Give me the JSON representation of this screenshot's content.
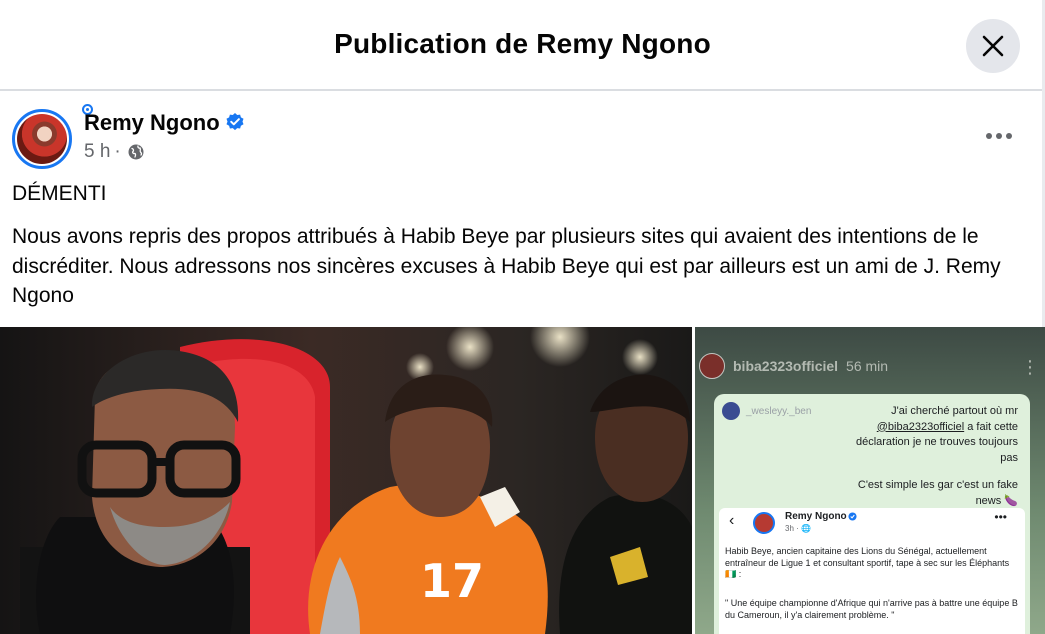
{
  "modal": {
    "title": "Publication de Remy Ngono",
    "close_icon": "close-icon"
  },
  "post": {
    "author": "Remy Ngono",
    "verified_icon": "verified-badge-icon",
    "time": "5 h",
    "separator": "·",
    "audience_icon": "globe-icon",
    "more_icon": "more-options-icon",
    "heading": "DÉMENTI",
    "body": "Nous avons repris des propos attribués à Habib Beye par plusieurs sites qui avaient des intentions de le discréditer. Nous adressons nos sincères excuses à Habib Beye qui est par ailleurs est un ami de J. Remy Ngono"
  },
  "media": {
    "jersey_number": "17",
    "story": {
      "user": "biba2323officiel",
      "time": "56 min",
      "reply_user": "_wesleyy._ben",
      "message_before": "J'ai cherché partout où mr ",
      "message_mention": "@biba2323officiel",
      "message_after": " a fait cette déclaration je ne trouves toujours pas",
      "message2": "C'est simple les gar c'est un fake news 🍆",
      "inner_author": "Remy Ngono",
      "inner_meta": "3h · 🌐",
      "inner_text": "Habib Beye, ancien capitaine des Lions du Sénégal, actuellement entraîneur de Ligue 1 et consultant sportif, tape à sec sur les Éléphants 🇨🇮 :",
      "inner_quote": "\" Une équipe championne d'Afrique qui n'arrive pas à battre une équipe B du Cameroun,  il y'a clairement problème. \""
    }
  },
  "colors": {
    "accent": "#1877f2",
    "secondary_text": "#65676b",
    "divider": "#dadde1",
    "close_bg": "#e4e6eb"
  }
}
